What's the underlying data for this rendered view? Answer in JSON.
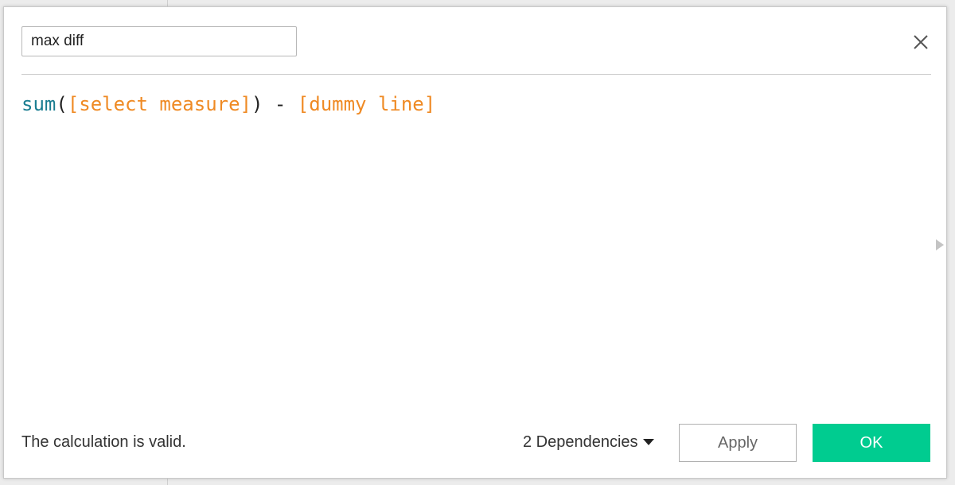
{
  "calculation": {
    "name": "max diff",
    "formula_tokens": [
      {
        "text": "sum",
        "kind": "function"
      },
      {
        "text": "(",
        "kind": "plain"
      },
      {
        "text": "[select measure]",
        "kind": "field"
      },
      {
        "text": ") - ",
        "kind": "plain"
      },
      {
        "text": "[dummy line]",
        "kind": "field"
      }
    ]
  },
  "footer": {
    "status": "The calculation is valid.",
    "dependencies_label": "2 Dependencies",
    "apply_label": "Apply",
    "ok_label": "OK"
  },
  "icons": {
    "close": "close-icon",
    "side_panel": "triangle-right-icon",
    "dependencies": "caret-down-icon"
  },
  "colors": {
    "function_token": "#1a7d91",
    "field_token": "#ef8a24",
    "ok_button": "#00cc90"
  }
}
